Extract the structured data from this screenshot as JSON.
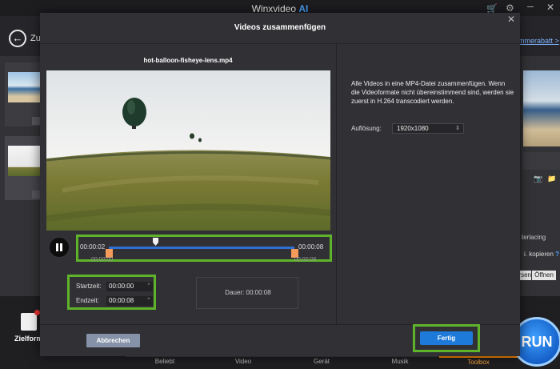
{
  "app": {
    "title_main": "Winxvideo",
    "title_ai": "AI",
    "back_label": "Zu",
    "promo_link": "mmerabatt >",
    "cart_icon": "cart-icon",
    "settings_icon": "gear-icon"
  },
  "right_panel": {
    "interlacing_label": "terlacing",
    "copy_label": "i. kopieren",
    "copy_help": "?",
    "browse_label": "rsen",
    "open_label": "Öffnen"
  },
  "bottom": {
    "target_label": "Zielform",
    "tabs": [
      "Beliebt",
      "Video",
      "Gerät",
      "Musik",
      "Toolbox"
    ],
    "active_tab": "Toolbox",
    "run_label": "RUN"
  },
  "modal": {
    "title": "Videos zusammenfügen",
    "file_name": "hot-balloon-fisheye-lens.mp4",
    "timeline": {
      "current_start": "00:00:02",
      "current_end": "00:00:08",
      "range_start": "00:00:00",
      "range_end": "00:00:08",
      "playhead_fraction": 0.25
    },
    "start_label": "Startzeit:",
    "start_value": "00:00:00",
    "end_label": "Endzeit:",
    "end_value": "00:00:08",
    "duration_label": "Dauer:",
    "duration_value": "00:00:08",
    "info_text": "Alle Videos in eine MP4-Datei zusammenfügen. Wenn die Videoformate nicht übereinstimmend sind, werden sie zuerst in H.264 transcodiert werden.",
    "resolution_label": "Auflösung:",
    "resolution_value": "1920x1080",
    "cancel_label": "Abbrechen",
    "finish_label": "Fertig",
    "highlight_color": "#5fb32b",
    "accent_color": "#1d7ad8"
  }
}
